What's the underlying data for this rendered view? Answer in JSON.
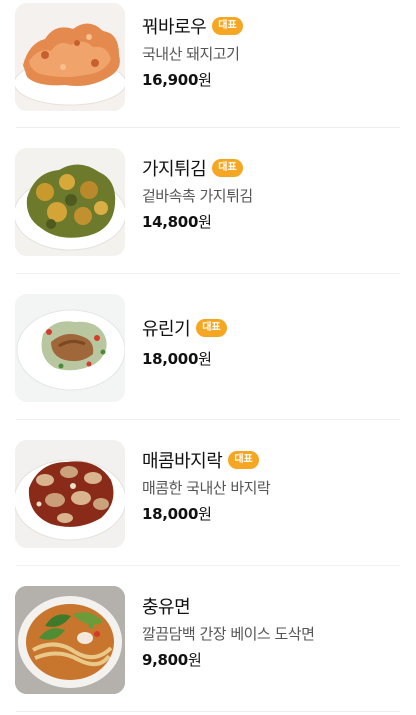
{
  "menu": {
    "items": [
      {
        "name": "꿔바로우",
        "badge": "대표",
        "description": "국내산 돼지고기",
        "price": "16,900",
        "currency": "원",
        "image_icon": "fried-pork-dish"
      },
      {
        "name": "가지튀김",
        "badge": "대표",
        "description": "겉바속촉 가지튀김",
        "price": "14,800",
        "currency": "원",
        "image_icon": "fried-eggplant-dish"
      },
      {
        "name": "유린기",
        "badge": "대표",
        "description": "",
        "price": "18,000",
        "currency": "원",
        "image_icon": "fried-chicken-salad-dish"
      },
      {
        "name": "매콤바지락",
        "badge": "대표",
        "description": "매콤한 국내산 바지락",
        "price": "18,000",
        "currency": "원",
        "image_icon": "spicy-clam-dish"
      },
      {
        "name": "충유면",
        "badge": "",
        "description": "깔끔담백 간장 베이스 도삭면",
        "price": "9,800",
        "currency": "원",
        "image_icon": "noodle-soup-bowl"
      }
    ]
  },
  "colors": {
    "badge": "#f5a623",
    "divider": "#efefef",
    "description": "#555555"
  }
}
